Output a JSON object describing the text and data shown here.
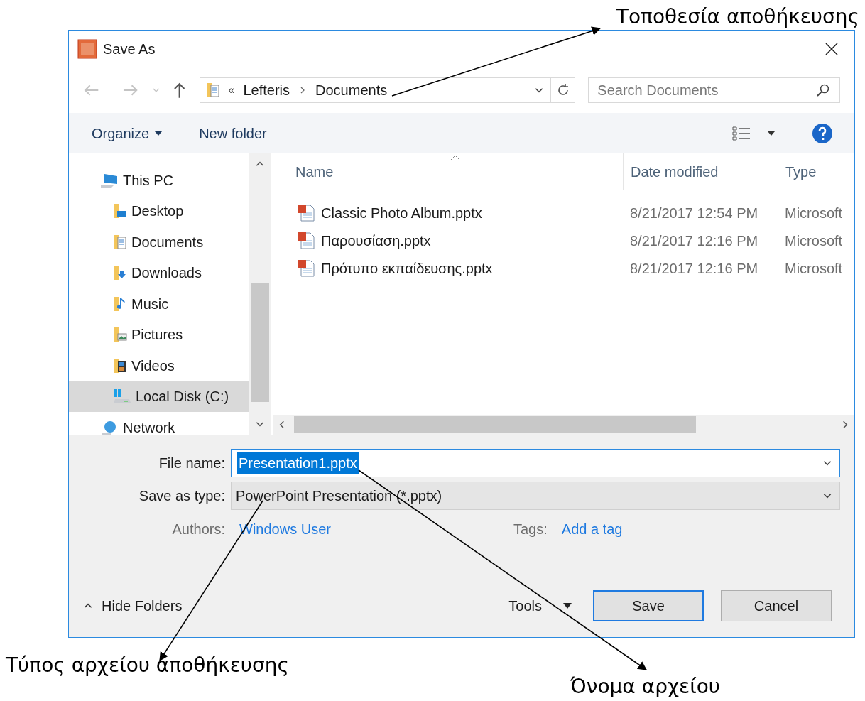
{
  "annotations": [
    {
      "text": "Τοποθεσία αποθήκευσης"
    },
    {
      "text": "Τύπος αρχείου αποθήκευσης"
    },
    {
      "text": "Όνομα αρχείου"
    }
  ],
  "window": {
    "title": "Save As"
  },
  "address_bar": {
    "overflow": "«",
    "path": [
      "Lefteris",
      "Documents"
    ]
  },
  "search": {
    "placeholder": "Search Documents"
  },
  "toolbar": {
    "organize": "Organize",
    "new_folder": "New folder"
  },
  "nav": {
    "items": [
      {
        "label": "This PC",
        "kind": "pc",
        "selected": false,
        "children": [
          {
            "label": "Desktop",
            "kind": "desktop",
            "selected": false
          },
          {
            "label": "Documents",
            "kind": "documents",
            "selected": false
          },
          {
            "label": "Downloads",
            "kind": "downloads",
            "selected": false
          },
          {
            "label": "Music",
            "kind": "music",
            "selected": false
          },
          {
            "label": "Pictures",
            "kind": "pictures",
            "selected": false
          },
          {
            "label": "Videos",
            "kind": "videos",
            "selected": false
          },
          {
            "label": "Local Disk (C:)",
            "kind": "disk",
            "selected": true
          }
        ]
      },
      {
        "label": "Network",
        "kind": "network",
        "selected": false
      }
    ]
  },
  "table": {
    "columns": [
      "Name",
      "Date modified",
      "Type"
    ],
    "rows": [
      {
        "name": "Classic Photo Album.pptx",
        "date": "8/21/2017 12:54 PM",
        "type": "Microsoft"
      },
      {
        "name": "Παρουσίαση.pptx",
        "date": "8/21/2017 12:16 PM",
        "type": "Microsoft"
      },
      {
        "name": "Πρότυπο εκπαίδευσης.pptx",
        "date": "8/21/2017 12:16 PM",
        "type": "Microsoft"
      }
    ]
  },
  "form": {
    "file_name_label": "File name:",
    "file_name": "Presentation1.pptx",
    "file_name_selected": true,
    "save_type_label": "Save as type:",
    "save_type": "PowerPoint Presentation (*.pptx)",
    "authors_label": "Authors:",
    "authors": "Windows User",
    "tags_label": "Tags:",
    "tags": "Add a tag"
  },
  "footer": {
    "hide_folders": "Hide Folders",
    "tools": "Tools",
    "save": "Save",
    "cancel": "Cancel"
  }
}
